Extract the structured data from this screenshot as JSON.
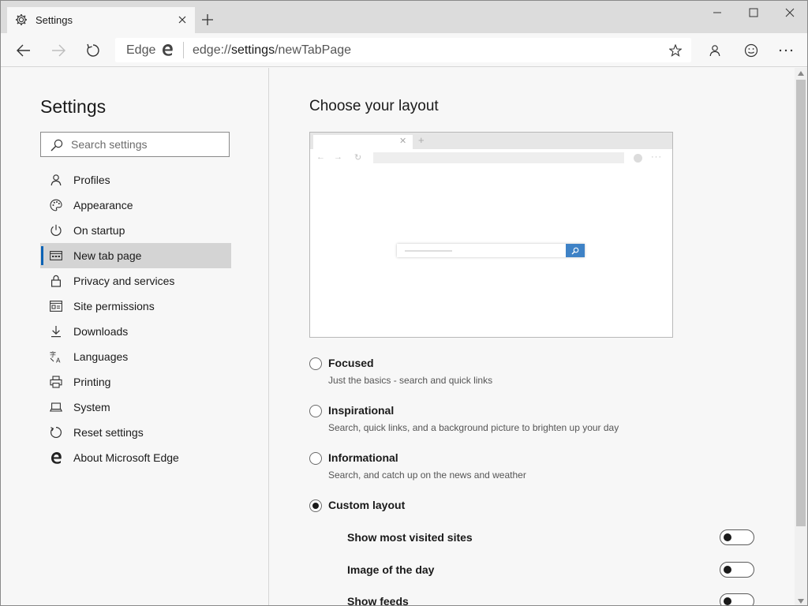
{
  "window": {
    "tab_title": "Settings",
    "icons": {
      "tab": "gear-icon",
      "tab_close": "close-icon",
      "new_tab": "plus-icon",
      "minimize": "minimize-icon",
      "maximize": "maximize-icon",
      "close": "close-icon"
    }
  },
  "toolbar": {
    "omnibox_label": "Edge",
    "url_prefix": "edge://",
    "url_host": "settings",
    "url_path": "/newTabPage",
    "icons": [
      "back-icon",
      "forward-icon",
      "refresh-icon",
      "edge-logo-icon",
      "star-icon",
      "profile-icon",
      "emoji-icon",
      "more-icon"
    ]
  },
  "sidebar": {
    "title": "Settings",
    "search_placeholder": "Search settings",
    "items": [
      {
        "label": "Profiles",
        "icon": "person-icon",
        "active": false
      },
      {
        "label": "Appearance",
        "icon": "palette-icon",
        "active": false
      },
      {
        "label": "On startup",
        "icon": "power-icon",
        "active": false
      },
      {
        "label": "New tab page",
        "icon": "newtab-icon",
        "active": true
      },
      {
        "label": "Privacy and services",
        "icon": "lock-icon",
        "active": false
      },
      {
        "label": "Site permissions",
        "icon": "site-permissions-icon",
        "active": false
      },
      {
        "label": "Downloads",
        "icon": "download-icon",
        "active": false
      },
      {
        "label": "Languages",
        "icon": "languages-icon",
        "active": false
      },
      {
        "label": "Printing",
        "icon": "printer-icon",
        "active": false
      },
      {
        "label": "System",
        "icon": "laptop-icon",
        "active": false
      },
      {
        "label": "Reset settings",
        "icon": "reset-icon",
        "active": false
      },
      {
        "label": "About Microsoft Edge",
        "icon": "edge-logo-icon",
        "active": false
      }
    ]
  },
  "main": {
    "heading": "Choose your layout",
    "options": [
      {
        "title": "Focused",
        "desc": "Just the basics - search and quick links",
        "checked": false
      },
      {
        "title": "Inspirational",
        "desc": "Search, quick links, and a background picture to brighten up your day",
        "checked": false
      },
      {
        "title": "Informational",
        "desc": "Search, and catch up on the news and weather",
        "checked": false
      },
      {
        "title": "Custom layout",
        "desc": "",
        "checked": true
      }
    ],
    "toggles": [
      {
        "label": "Show most visited sites",
        "on": false
      },
      {
        "label": "Image of the day",
        "on": false
      },
      {
        "label": "Show feeds",
        "on": false
      }
    ]
  },
  "colors": {
    "accent": "#0b62b5",
    "preview_search_button": "#3e82c6",
    "active_nav_bg": "#d4d4d4"
  }
}
